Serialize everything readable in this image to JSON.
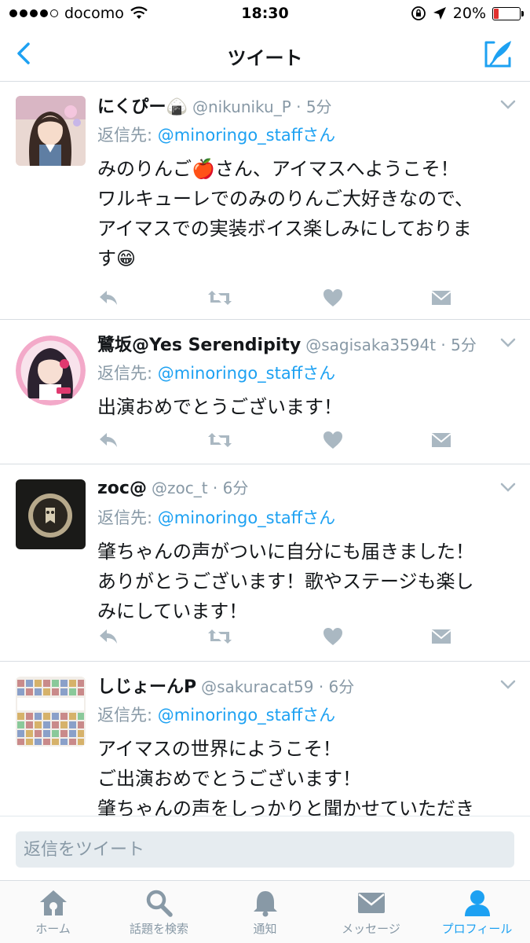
{
  "status_bar": {
    "carrier": "docomo",
    "time": "18:30",
    "battery": "20%",
    "battery_level": 0.2
  },
  "nav": {
    "title": "ツイート"
  },
  "tweets": [
    {
      "name": "にくぴー🍙",
      "handle": "@nikuniku_P · 5分",
      "reply_label": "返信先: ",
      "reply_to": "@minoringo_staffさん",
      "lines": [
        "みのりんご🍎さん、アイマスへようこそ！",
        "ワルキューレでのみのりんご大好きなので、",
        "アイマスでの実装ボイス楽しみにしておりま",
        "す😁"
      ]
    },
    {
      "name": "鷺坂@Yes Serendipity",
      "handle": "@sagisaka3594t · 5分",
      "reply_label": "返信先: ",
      "reply_to": "@minoringo_staffさん",
      "lines": [
        "出演おめでとうございます！"
      ]
    },
    {
      "name": "zoc@",
      "handle": "@zoc_t · 6分",
      "reply_label": "返信先: ",
      "reply_to": "@minoringo_staffさん",
      "lines": [
        "肇ちゃんの声がついに自分にも届きました！",
        "ありがとうございます！歌やステージも楽し",
        "みにしています！"
      ]
    },
    {
      "name": "しじょーんP",
      "handle": "@sakuracat59 · 6分",
      "reply_label": "返信先: ",
      "reply_to": "@minoringo_staffさん",
      "lines": [
        "アイマスの世界にようこそ！",
        "ご出演おめでとうございます！",
        "肇ちゃんの声をしっかりと聞かせていただき"
      ]
    }
  ],
  "reply_bar": {
    "placeholder": "返信をツイート"
  },
  "tabs": [
    {
      "label": "ホーム",
      "icon": "home-icon"
    },
    {
      "label": "話題を検索",
      "icon": "search-icon"
    },
    {
      "label": "通知",
      "icon": "bell-icon"
    },
    {
      "label": "メッセージ",
      "icon": "envelope-icon"
    },
    {
      "label": "プロフィール",
      "icon": "person-icon",
      "active": true
    }
  ],
  "colors": {
    "accent": "#1da1f2",
    "muted": "#8899a6",
    "battery_low": "#e0302e"
  }
}
